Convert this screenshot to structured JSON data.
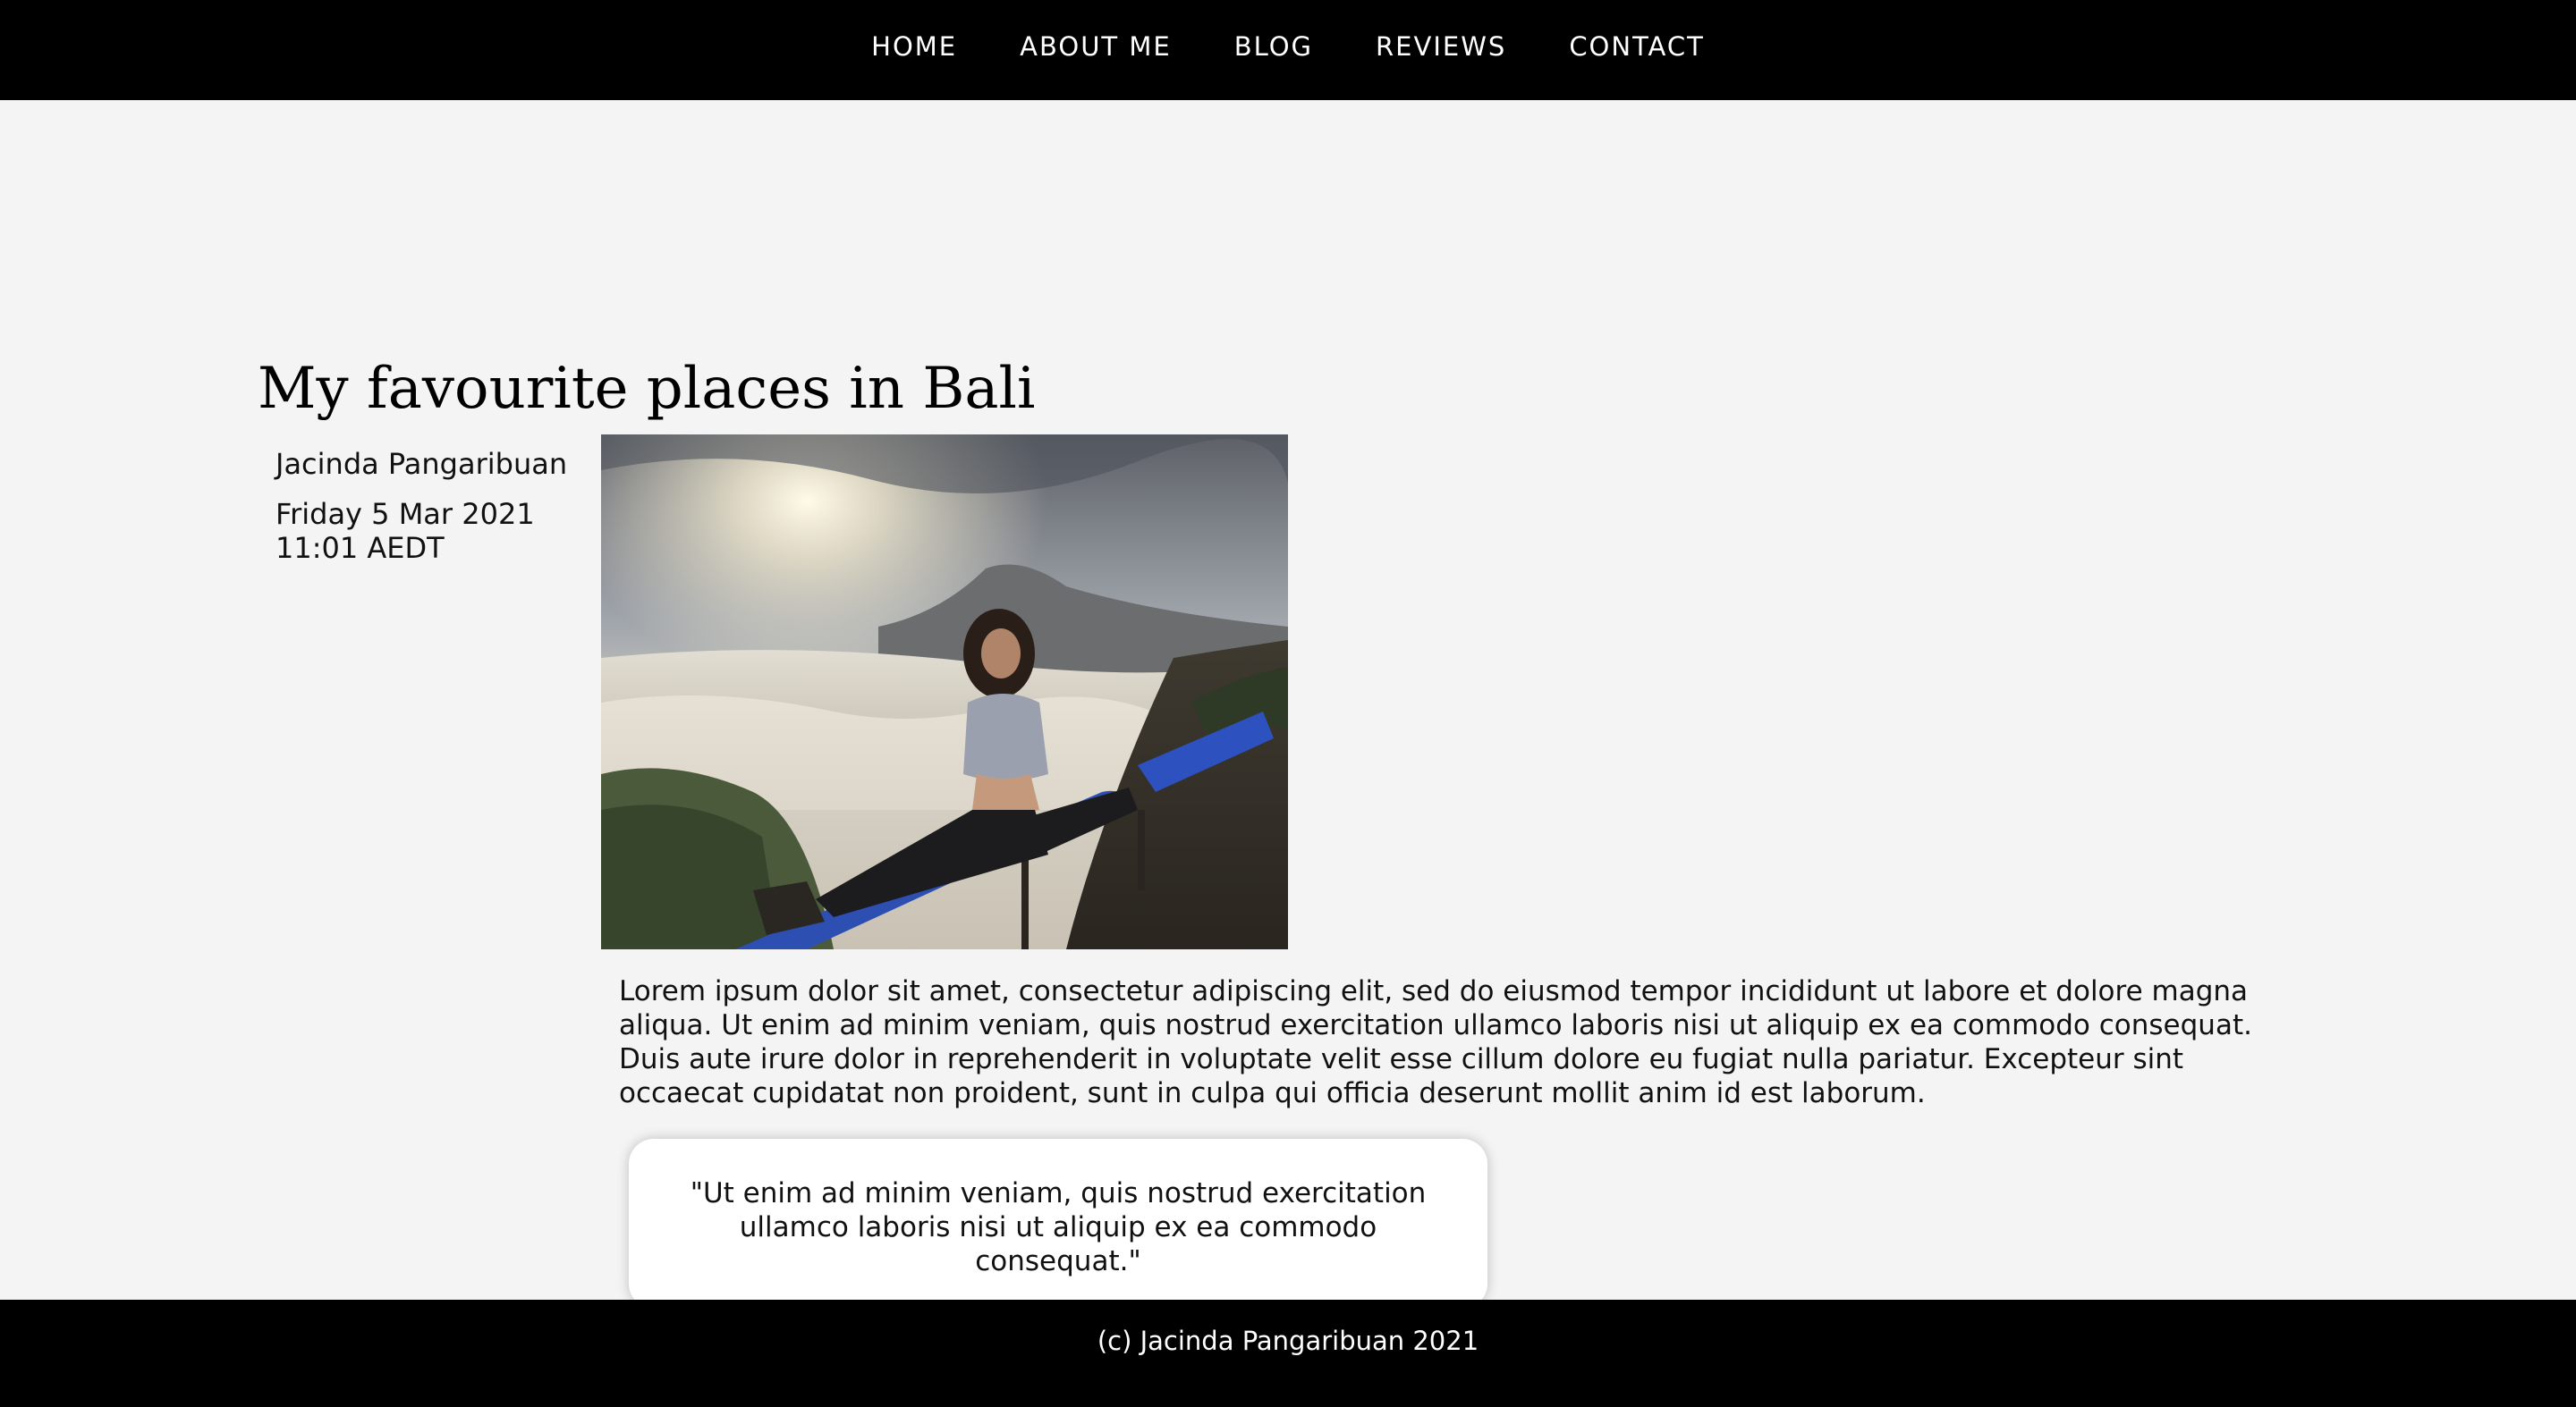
{
  "nav": {
    "items": [
      {
        "label": "HOME"
      },
      {
        "label": "ABOUT ME"
      },
      {
        "label": "BLOG"
      },
      {
        "label": "REVIEWS"
      },
      {
        "label": "CONTACT"
      }
    ]
  },
  "post": {
    "title": "My favourite places in Bali",
    "author": "Jacinda Pangaribuan",
    "date": "Friday 5 Mar 2021 11:01 AEDT",
    "body": "Lorem ipsum dolor sit amet, consectetur adipiscing elit, sed do eiusmod tempor incididunt ut labore et dolore magna aliqua. Ut enim ad minim veniam, quis nostrud exercitation ullamco laboris nisi ut aliquip ex ea commodo consequat. Duis aute irure dolor in reprehenderit in voluptate velit esse cillum dolore eu fugiat nulla pariatur. Excepteur sint occaecat cupidatat non proident, sunt in culpa qui officia deserunt mollit anim id est laborum.",
    "quote": "\"Ut enim ad minim veniam, quis nostrud exercitation ullamco laboris nisi ut aliquip ex ea commodo consequat.\""
  },
  "footer": {
    "text": "(c) Jacinda Pangaribuan 2021"
  },
  "colors": {
    "nav_background": "#000000",
    "page_background": "#f4f4f4",
    "footer_background": "#000000",
    "text": "#111111"
  }
}
